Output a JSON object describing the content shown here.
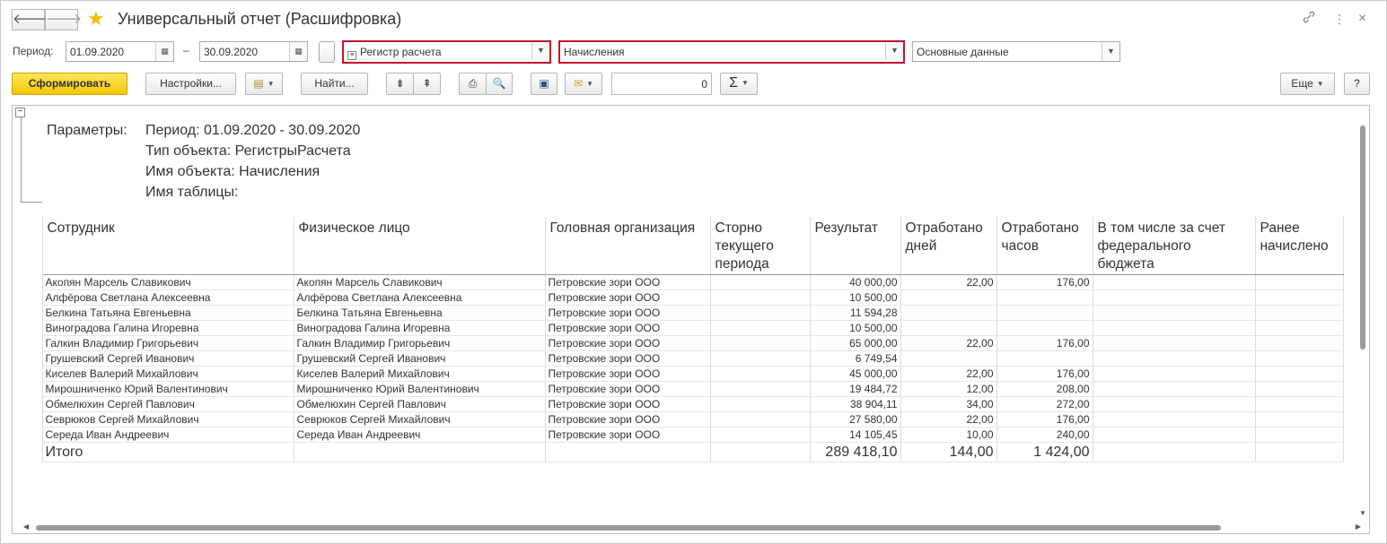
{
  "window": {
    "title": "Универсальный отчет (Расшифровка)",
    "back_icon": "arrow-left-icon",
    "forward_icon": "arrow-right-icon",
    "favorite_icon": "star-icon",
    "link_icon": "link-icon",
    "more_icon": "vertical-dots-icon",
    "close_icon": "close-icon"
  },
  "period": {
    "label": "Период:",
    "from": "01.09.2020",
    "dash": "–",
    "to": "30.09.2020"
  },
  "selectors": {
    "object_type": "Регистр расчета",
    "object_name": "Начисления",
    "table_name": "Основные данные"
  },
  "toolbar": {
    "generate": "Сформировать",
    "settings": "Настройки...",
    "find": "Найти...",
    "number_value": "0",
    "sigma": "Σ",
    "more": "Еще",
    "help": "?"
  },
  "params": {
    "label": "Параметры:",
    "lines": [
      "Период: 01.09.2020 - 30.09.2020",
      "Тип объекта: РегистрыРасчета",
      "Имя объекта: Начисления",
      "Имя таблицы:"
    ]
  },
  "table": {
    "headers": [
      "Сотрудник",
      "Физическое лицо",
      "Головная организация",
      "Сторно текущего периода",
      "Результат",
      "Отработано дней",
      "Отработано часов",
      "В том числе за счет федерального бюджета",
      "Ранее начислено"
    ],
    "rows": [
      [
        "Акопян Марсель Славикович",
        "Акопян Марсель Славикович",
        "Петровские зори ООО",
        "",
        "40 000,00",
        "22,00",
        "176,00",
        "",
        ""
      ],
      [
        "Алфёрова Светлана Алексеевна",
        "Алфёрова Светлана Алексеевна",
        "Петровские зори ООО",
        "",
        "10 500,00",
        "",
        "",
        "",
        ""
      ],
      [
        "Белкина Татьяна Евгеньевна",
        "Белкина Татьяна Евгеньевна",
        "Петровские зори ООО",
        "",
        "11 594,28",
        "",
        "",
        "",
        ""
      ],
      [
        "Виноградова Галина Игоревна",
        "Виноградова Галина Игоревна",
        "Петровские зори ООО",
        "",
        "10 500,00",
        "",
        "",
        "",
        ""
      ],
      [
        "Галкин Владимир Григорьевич",
        "Галкин Владимир Григорьевич",
        "Петровские зори ООО",
        "",
        "65 000,00",
        "22,00",
        "176,00",
        "",
        ""
      ],
      [
        "Грушевский Сергей Иванович",
        "Грушевский Сергей Иванович",
        "Петровские зори ООО",
        "",
        "6 749,54",
        "",
        "",
        "",
        ""
      ],
      [
        "Киселев Валерий Михайлович",
        "Киселев Валерий Михайлович",
        "Петровские зори ООО",
        "",
        "45 000,00",
        "22,00",
        "176,00",
        "",
        ""
      ],
      [
        "Мирошниченко Юрий Валентинович",
        "Мирошниченко Юрий Валентинович",
        "Петровские зори ООО",
        "",
        "19 484,72",
        "12,00",
        "208,00",
        "",
        ""
      ],
      [
        "Обмелюхин Сергей Павлович",
        "Обмелюхин Сергей Павлович",
        "Петровские зори ООО",
        "",
        "38 904,11",
        "34,00",
        "272,00",
        "",
        ""
      ],
      [
        "Севрюков Сергей Михайлович",
        "Севрюков Сергей Михайлович",
        "Петровские зори ООО",
        "",
        "27 580,00",
        "22,00",
        "176,00",
        "",
        ""
      ],
      [
        "Середа Иван Андреевич",
        "Середа Иван Андреевич",
        "Петровские зори ООО",
        "",
        "14 105,45",
        "10,00",
        "240,00",
        "",
        ""
      ]
    ],
    "total": [
      "Итого",
      "",
      "",
      "",
      "289 418,10",
      "144,00",
      "1 424,00",
      "",
      ""
    ]
  },
  "colors": {
    "primary_button": "#f5c800",
    "highlight_border": "#c8102e",
    "star": "#f0c000"
  }
}
